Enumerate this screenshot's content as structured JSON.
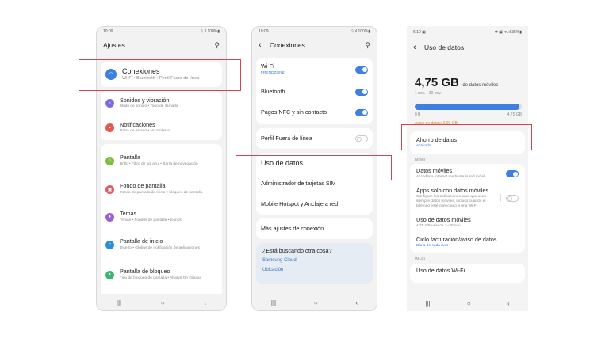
{
  "colors": {
    "accent": "#3e7fe0",
    "highlight": "#d9414e",
    "orange": "#e08a3a"
  },
  "p1": {
    "status_time": "10:09",
    "status_right": "⁰ᵢ.ıl 100%▮",
    "title": "Ajustes",
    "conexiones": {
      "title": "Conexiones",
      "sub": "Wi-Fi  •  Bluetooth  •  Perfil Fuera de línea"
    },
    "items": [
      {
        "title": "Sonidos y vibración",
        "sub": "Modo de sonido  •  Tono de llamada",
        "color": "#7e6be0"
      },
      {
        "title": "Notificaciones",
        "sub": "Barra de estado  •  No molestar",
        "color": "#e35a4f"
      },
      {
        "title": "Pantalla",
        "sub": "Brillo  •  Filtro de luz azul  •  Barra de navegación",
        "color": "#7fbf3f"
      },
      {
        "title": "Fondo de pantalla",
        "sub": "Fondo de pantalla de inicio y bloqueo de pantalla",
        "color": "#e35a6a"
      },
      {
        "title": "Temas",
        "sub": "Temas  •  Fondos de pantalla  •  Iconos",
        "color": "#9b5fd6"
      },
      {
        "title": "Pantalla de inicio",
        "sub": "Diseño  •  Globos de notificación de aplicaciones",
        "color": "#2a8fd6"
      },
      {
        "title": "Pantalla de bloqueo",
        "sub": "Tipo de bloqueo de pantalla  •  Always On Display",
        "color": "#3fb36f"
      }
    ]
  },
  "p2": {
    "status_time": "10:09",
    "status_right": "⁰ᵢ.ıl 100%▮",
    "title": "Conexiones",
    "wifi": {
      "title": "Wi-Fi",
      "sub": "FRENDZONE"
    },
    "bluetooth": "Bluetooth",
    "nfc": "Pagos NFC y sin contacto",
    "perfil": "Perfil Fuera de línea",
    "uso": "Uso de datos",
    "sim": "Administrador de tarjetas SIM",
    "hotspot": "Mobile Hotspot y Anclaje a red",
    "mas": "Más ajustes de conexión",
    "buscando": "¿Está buscando otra cosa?",
    "links": [
      "Samsung Cloud",
      "Ubicación"
    ]
  },
  "p3": {
    "status_time": "6:10 ▣",
    "status_right": "✱ ▣ ᯤ.ıl 35%▮",
    "title": "Uso de datos",
    "amount": "4,75 GB",
    "amount_label": "de datos móviles",
    "period": "1 nov. - 30 nov.",
    "bar_fraction": 0.98,
    "scale_left": "0 B",
    "scale_right": "4,75 GB",
    "warning": "Aviso de datos: 2,00 GB",
    "ahorro": {
      "title": "Ahorro de datos",
      "sub": "Activado"
    },
    "section_movil": "Móvil",
    "datos_moviles": {
      "title": "Datos móviles",
      "sub": "Acceder a Internet mediante la red móvil."
    },
    "apps": {
      "title": "Apps solo con datos móviles",
      "sub": "Configure las aplicaciones para que usen siempre datos móviles, incluso cuando el teléfono esté conectado a una Wi-Fi."
    },
    "uso_moviles": {
      "title": "Uso de datos móviles",
      "sub": "4,75 GB usados 1–30 nov."
    },
    "ciclo": {
      "title": "Ciclo facturación/aviso de datos",
      "sub": "Día 1 de cada mes"
    },
    "section_wifi": "Wi-Fi",
    "uso_wifi": "Uso de datos Wi-Fi"
  },
  "nav": {
    "recent": "|||",
    "home": "○",
    "back": "‹"
  }
}
